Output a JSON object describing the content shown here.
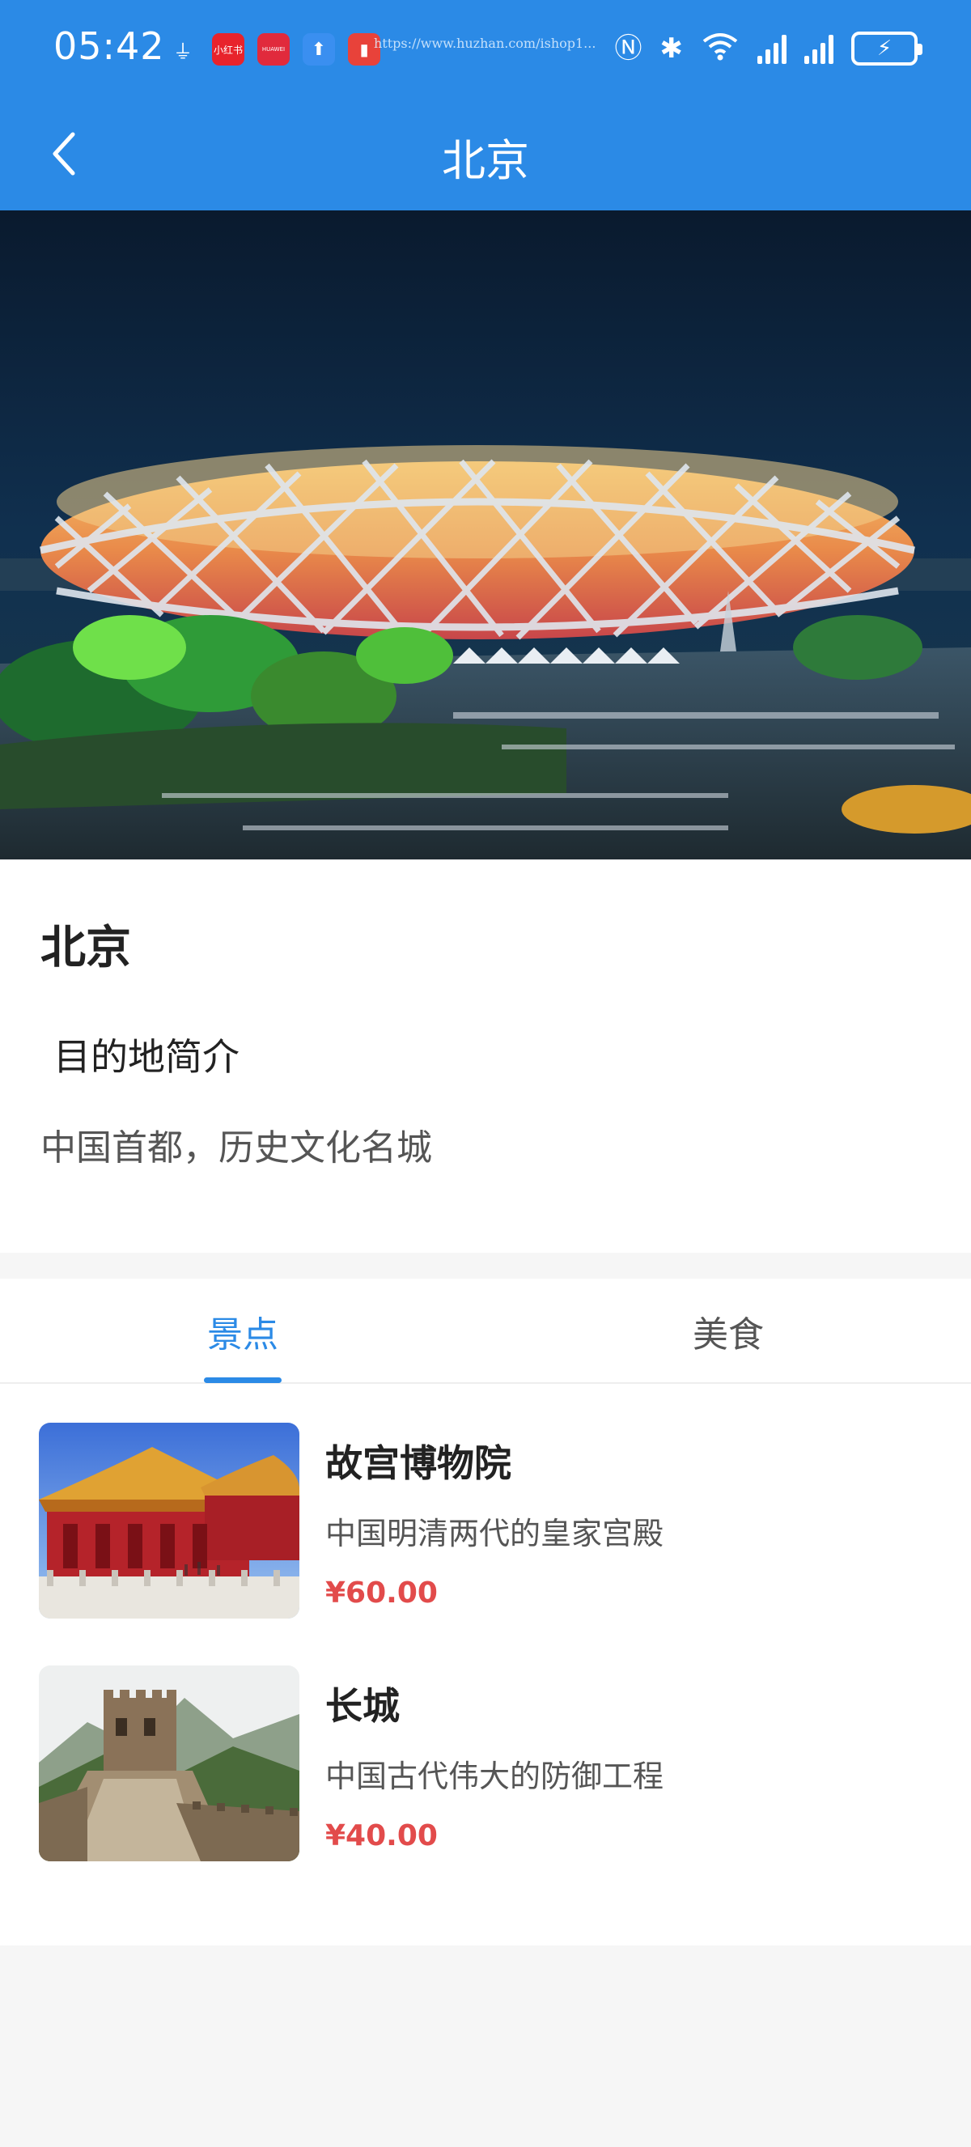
{
  "status_bar": {
    "time": "05:42",
    "url_text": "https://www.huzhan.com/ishop1...",
    "notif_labels": [
      "小红书",
      "HUAWEI"
    ]
  },
  "header": {
    "title": "北京",
    "back_icon": "chevron-left-icon"
  },
  "hero": {
    "image_icon": "stadium-night-photo"
  },
  "intro": {
    "name": "北京",
    "heading": "目的地简介",
    "description": "中国首都，历史文化名城"
  },
  "tabs": [
    {
      "label": "景点",
      "active": true
    },
    {
      "label": "美食",
      "active": false
    }
  ],
  "attractions": [
    {
      "title": "故宫博物院",
      "description": "中国明清两代的皇家宫殿",
      "price": "¥60.00",
      "image_icon": "forbidden-city-photo"
    },
    {
      "title": "长城",
      "description": "中国古代伟大的防御工程",
      "price": "¥40.00",
      "image_icon": "great-wall-photo"
    }
  ],
  "colors": {
    "primary": "#2b8ae6",
    "price": "#e24b4b",
    "background": "#f6f6f6"
  }
}
